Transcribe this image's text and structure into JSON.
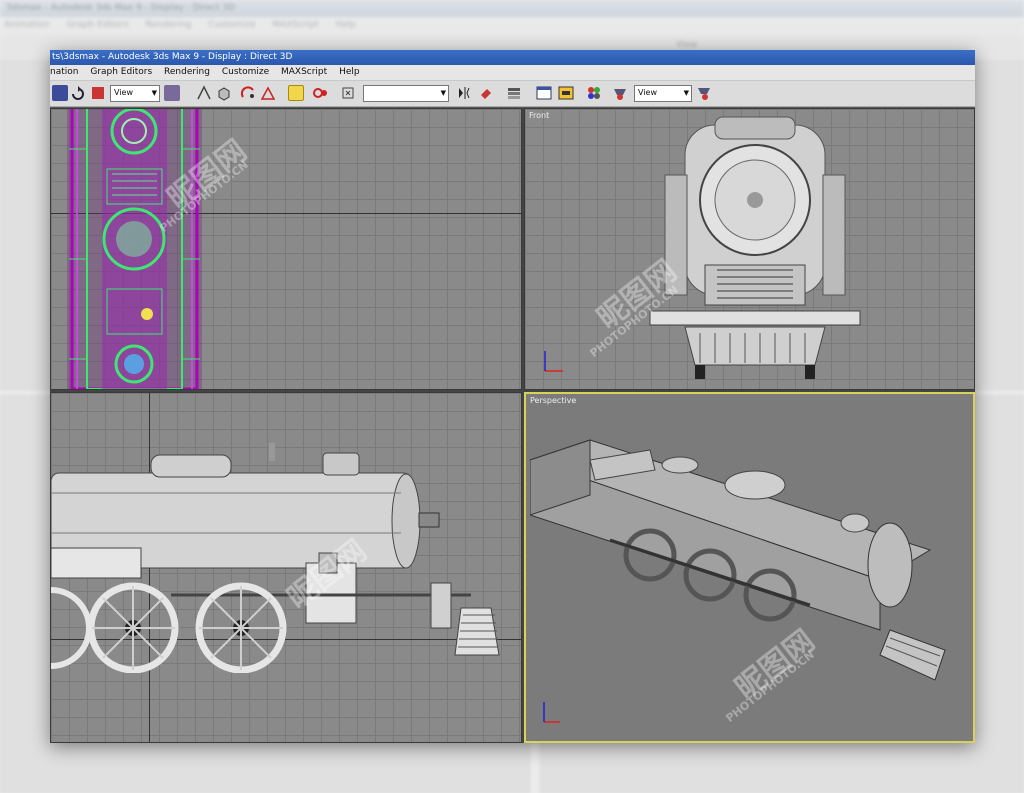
{
  "background": {
    "title": "3dsmax - Autodesk 3ds Max 9 - Display : Direct 3D",
    "menu": [
      "Animation",
      "Graph Editors",
      "Rendering",
      "Customize",
      "MAXScript",
      "Help"
    ],
    "view_label": "View"
  },
  "window": {
    "title": "ts\\3dsmax  - Autodesk 3ds Max 9  - Display : Direct 3D",
    "menu": {
      "animation": "nation",
      "graph_editors": "Graph Editors",
      "rendering": "Rendering",
      "customize": "Customize",
      "maxscript": "MAXScript",
      "help": "Help"
    },
    "toolbar": {
      "view_dropdown_1": "View",
      "selection_set": "",
      "view_dropdown_2": "View"
    }
  },
  "viewports": {
    "top": {
      "label": ""
    },
    "front": {
      "label": "Front"
    },
    "left": {
      "label": ""
    },
    "perspective": {
      "label": "Perspective"
    }
  },
  "watermark": {
    "logo": "昵图网",
    "text": "PHOTOPHOTO.CN"
  },
  "colors": {
    "grid_bg": "#8a8a8a",
    "active_viewport_border": "#d8d25a",
    "titlebar": "#2a58ad",
    "wireframe_magenta": "#b000c0",
    "wireframe_green": "#3ee870"
  }
}
